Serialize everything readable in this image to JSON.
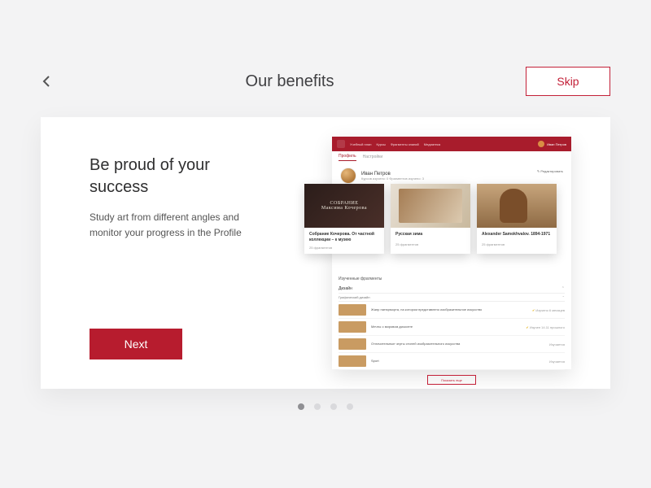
{
  "header": {
    "title": "Our benefits",
    "skip": "Skip"
  },
  "content": {
    "heading": "Be proud of your success",
    "body": "Study art from different angles and monitor your progress in the Profile",
    "next": "Next"
  },
  "mock": {
    "nav": [
      "Учебный план",
      "Курсы",
      "Фрагменты знаний",
      "Медиатека"
    ],
    "user": "Иван Петров",
    "tabs": [
      "Профиль",
      "Настройки"
    ],
    "profile": {
      "name": "Иван Петров",
      "meta": "Курсов изучено: 0     Фрагментов изучено: 3",
      "edit": "✎ Редактировать"
    },
    "cards": [
      {
        "title": "Собрание Кочерова. От частной коллекции – к музею",
        "sub": "25 фрагментов",
        "overlay": "СОБРАНИЕ\\AМаксима Кочерова"
      },
      {
        "title": "Русская зима",
        "sub": "25 фрагментов"
      },
      {
        "title": "Alexander Samokhvalov. 1894-1971",
        "sub": "25 фрагментов"
      }
    ],
    "frag": {
      "section": "Изученные фрагменты",
      "group": "Дизайн",
      "subgroup": "Графический дизайн",
      "rows": [
        {
          "txt": "Жанр натюрморта, на котором представлено изобразительное искусство",
          "stat": "Изучено 6 месяцев",
          "ok": true
        },
        {
          "txt": "Мечты о мировом дисконте",
          "stat": "Изучен 14.11 прошлого",
          "ok": true
        },
        {
          "txt": "Отличительные черты стилей изобразительного искусства",
          "stat": "Изучается",
          "ok": false
        },
        {
          "txt": "Sport",
          "stat": "Изучается",
          "ok": false
        }
      ],
      "more": "Показать еще"
    }
  },
  "pager": {
    "count": 4,
    "active": 0
  }
}
